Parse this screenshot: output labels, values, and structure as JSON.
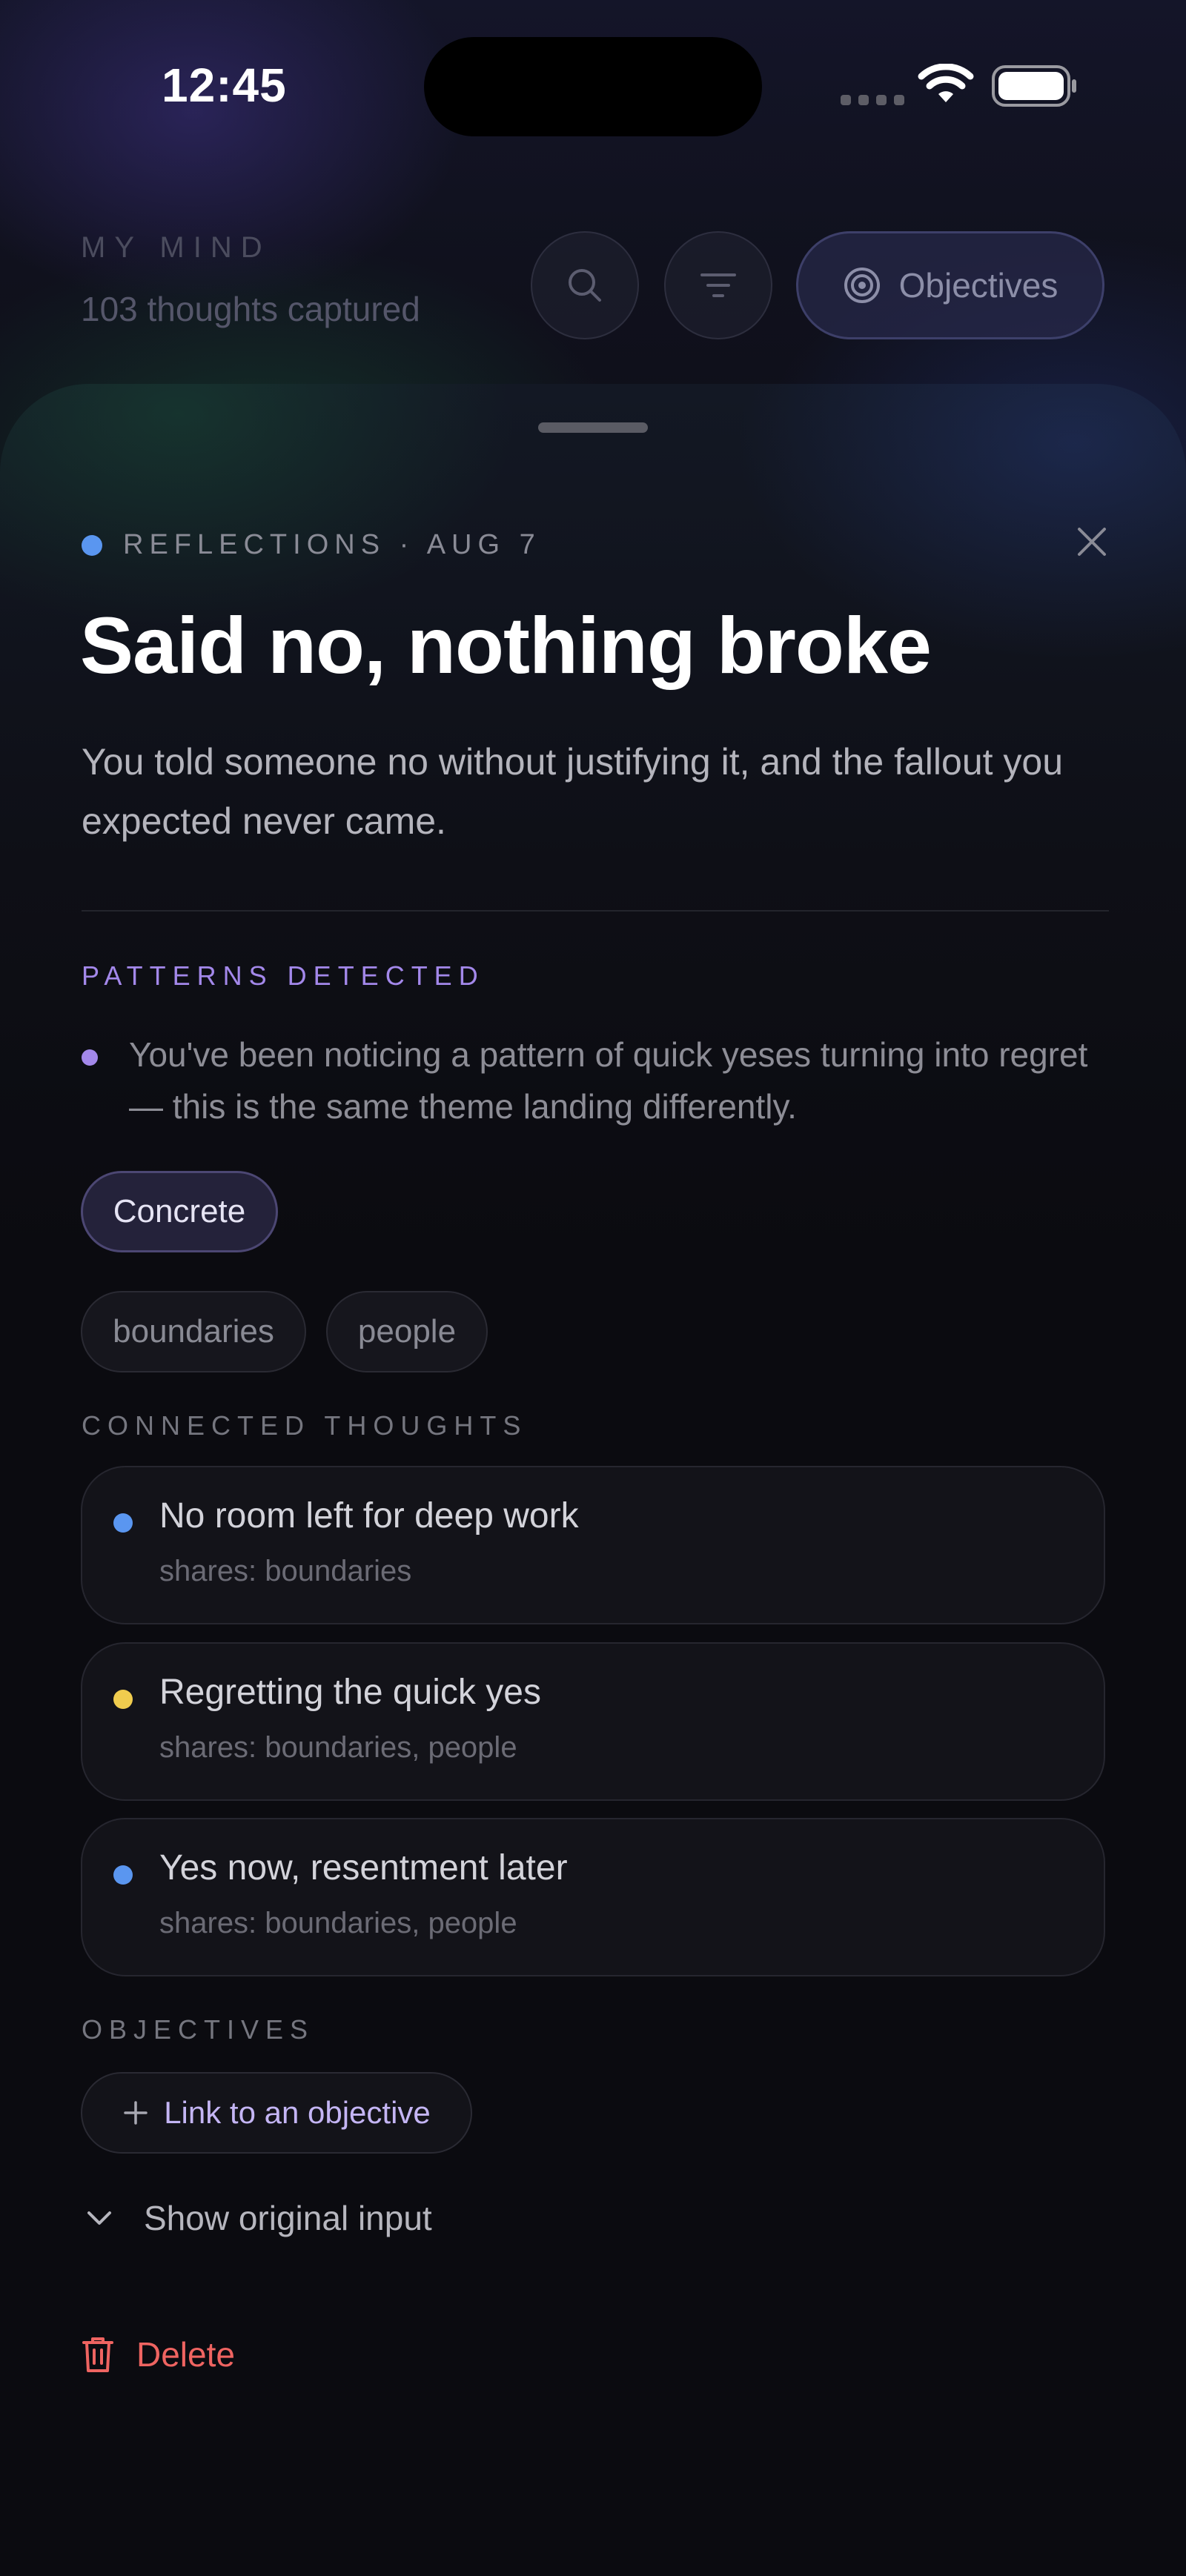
{
  "status_bar": {
    "time": "12:45"
  },
  "header": {
    "eyebrow": "MY MIND",
    "count_text": "103 thoughts captured",
    "objectives_label": "Objectives",
    "icons": [
      "search-icon",
      "filter-icon",
      "target-icon"
    ]
  },
  "sheet": {
    "category": "REFLECTIONS",
    "date": "AUG 7",
    "meta": "REFLECTIONS · AUG 7",
    "category_color": "#5a96f0",
    "title": "Said no, nothing broke",
    "summary": "You told someone no without justifying it, and the fallout you expected never came.",
    "patterns": {
      "label": "PATTERNS DETECTED",
      "items": [
        "You've been noticing a pattern of quick yeses turning into regret — this is the same theme landing differently."
      ],
      "accent": "#a388ea"
    },
    "type_pill": "Concrete",
    "tags": [
      "boundaries",
      "people"
    ],
    "connected": {
      "label": "CONNECTED THOUGHTS",
      "items": [
        {
          "title": "No room left for deep work",
          "shares": "shares: boundaries",
          "color": "#5a96f0"
        },
        {
          "title": "Regretting the quick yes",
          "shares": "shares: boundaries, people",
          "color": "#f0cc4e"
        },
        {
          "title": "Yes now, resentment later",
          "shares": "shares: boundaries, people",
          "color": "#5a96f0"
        }
      ]
    },
    "objectives": {
      "label": "OBJECTIVES",
      "link_label": "Link to an objective"
    },
    "show_original_label": "Show original input",
    "delete_label": "Delete",
    "delete_color": "#ef6461"
  }
}
